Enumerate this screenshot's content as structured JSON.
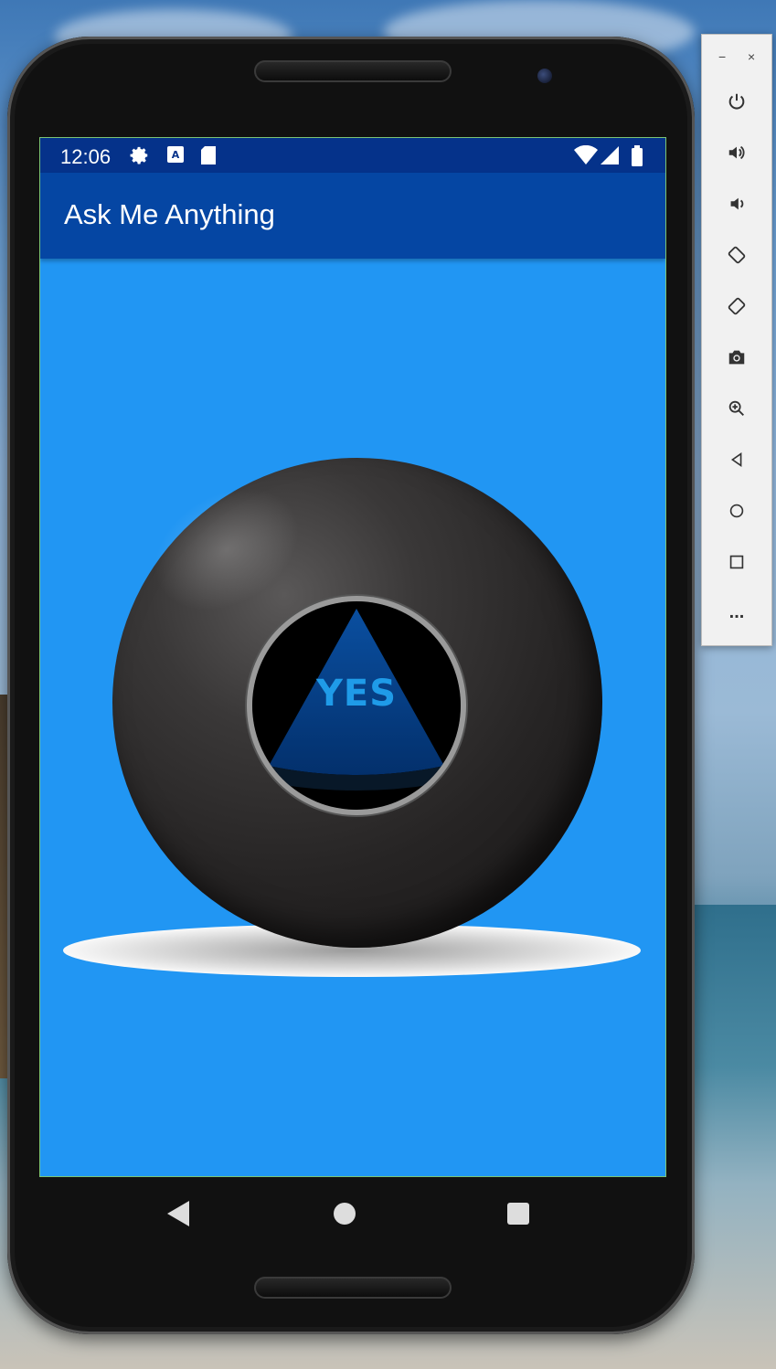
{
  "status_bar": {
    "time": "12:06",
    "icons": [
      "gear-icon",
      "a-keyboard-icon",
      "sd-card-icon",
      "wifi-icon",
      "signal-icon",
      "battery-icon"
    ]
  },
  "app_bar": {
    "title": "Ask Me Anything"
  },
  "magic_ball": {
    "answer": "YES"
  },
  "nav_bar": {
    "icons": [
      "back-icon",
      "home-icon",
      "recents-icon"
    ]
  },
  "emulator_panel": {
    "window_buttons": [
      "−",
      "×"
    ],
    "buttons": [
      "power-icon",
      "volume-up-icon",
      "volume-down-icon",
      "rotate-left-icon",
      "rotate-right-icon",
      "camera-icon",
      "zoom-icon",
      "back-icon",
      "home-icon",
      "overview-icon",
      "more-icon"
    ],
    "more_label": "..."
  },
  "colors": {
    "screen_background": "#2196f3",
    "status_bar": "#05328a",
    "app_bar": "#0546a3",
    "answer_text": "#1f9be8"
  }
}
